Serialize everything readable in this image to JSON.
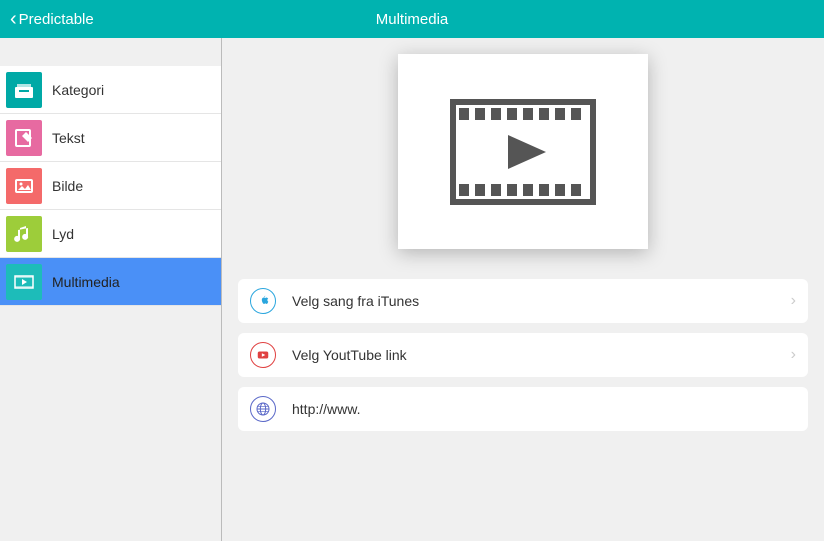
{
  "header": {
    "back_label": "Predictable",
    "title": "Multimedia"
  },
  "sidebar": {
    "items": [
      {
        "label": "Kategori",
        "icon": "category-icon",
        "color": "#00a9a6"
      },
      {
        "label": "Tekst",
        "icon": "text-icon",
        "color": "#e76aa1"
      },
      {
        "label": "Bilde",
        "icon": "image-icon",
        "color": "#f46a6a"
      },
      {
        "label": "Lyd",
        "icon": "sound-icon",
        "color": "#9dcd3a"
      },
      {
        "label": "Multimedia",
        "icon": "multimedia-icon",
        "color": "#1dbcb9",
        "active": true
      }
    ]
  },
  "main": {
    "options": [
      {
        "label": "Velg sang fra iTunes",
        "icon": "itunes-icon",
        "chevron": true
      },
      {
        "label": "Velg YoutTube link",
        "icon": "youtube-icon",
        "chevron": true
      }
    ],
    "url_input": {
      "value": "http://www."
    }
  },
  "colors": {
    "accent": "#00b3b0",
    "active_row": "#4a90f7"
  }
}
